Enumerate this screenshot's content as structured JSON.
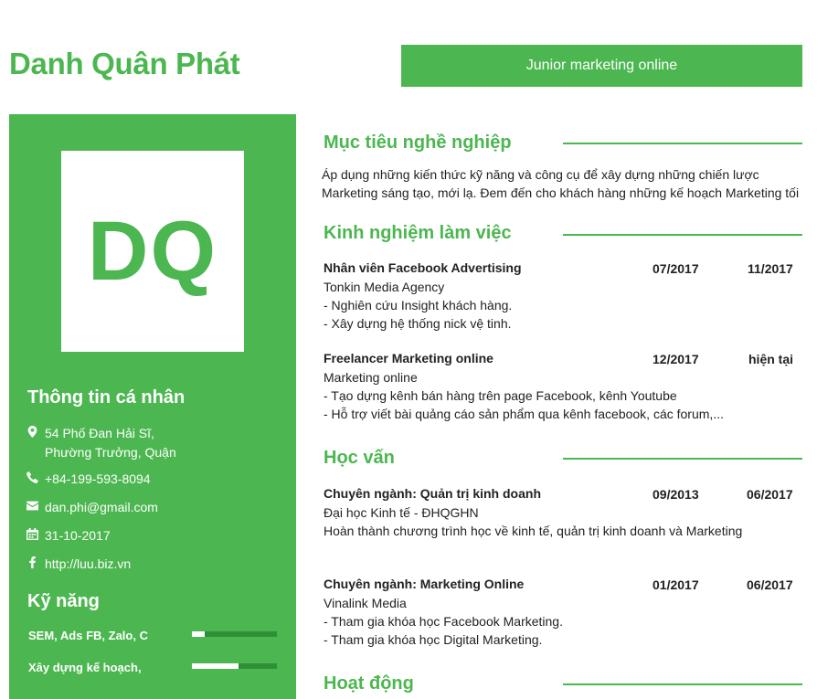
{
  "header": {
    "name": "Danh Quân Phát",
    "job_title": "Junior marketing online"
  },
  "sidebar": {
    "avatar_initials": "DQ",
    "personal_heading": "Thông tin cá nhân",
    "info": {
      "address_line1": "54 Phố Đan Hải Sĩ,",
      "address_line2": "Phường Trưởng, Quận",
      "phone": "+84-199-593-8094",
      "email": "dan.phi@gmail.com",
      "birthday": "31-10-2017",
      "website": "http://luu.biz.vn"
    },
    "icons": [
      "map-marker-icon",
      "phone-icon",
      "envelope-icon",
      "calendar-icon",
      "facebook-icon"
    ],
    "skills_heading": "Kỹ năng",
    "skills": [
      {
        "name": "SEM, Ads FB, Zalo, C",
        "level": 0.15
      },
      {
        "name": "Xây dựng kế hoạch,",
        "level": 0.55
      }
    ]
  },
  "objective": {
    "heading": "Mục tiêu nghề nghiệp",
    "line1": "Áp dụng những kiến thức kỹ năng và công cụ để xây dựng những chiến lược",
    "line2": "Marketing sáng tạo, mới lạ. Đem đến cho khách hàng những kế hoạch Marketing tối"
  },
  "experience": {
    "heading": "Kinh nghiệm làm việc",
    "entries": [
      {
        "title": "Nhân viên Facebook Advertising",
        "start": "07/2017",
        "end": "11/2017",
        "lines": [
          "Tonkin Media Agency",
          "- Nghiên cứu Insight khách hàng.",
          "- Xây dựng hệ thống nick vệ tinh."
        ]
      },
      {
        "title": "Freelancer Marketing online",
        "start": "12/2017",
        "end": "hiện tại",
        "lines": [
          "Marketing online",
          "- Tạo dựng kênh bán hàng trên page Facebook, kênh Youtube",
          "- Hỗ trợ viết bài quảng cáo sản phẩm qua kênh facebook, các forum,..."
        ]
      }
    ]
  },
  "education": {
    "heading": "Học vấn",
    "entries": [
      {
        "title": "Chuyên ngành: Quản trị kinh doanh",
        "start": "09/2013",
        "end": "06/2017",
        "lines": [
          "Đại học Kinh tế - ĐHQGHN",
          "Hoàn thành chương trình học về kinh tế, quản trị kinh doanh và Marketing"
        ]
      },
      {
        "title": "Chuyên ngành: Marketing Online",
        "start": "01/2017",
        "end": "06/2017",
        "lines": [
          "Vinalink Media",
          "- Tham gia khóa học Facebook Marketing.",
          "- Tham gia khóa học Digital Marketing."
        ]
      }
    ]
  },
  "activities": {
    "heading": "Hoạt động"
  },
  "colors": {
    "accent": "#4cb750",
    "text": "#222222"
  }
}
